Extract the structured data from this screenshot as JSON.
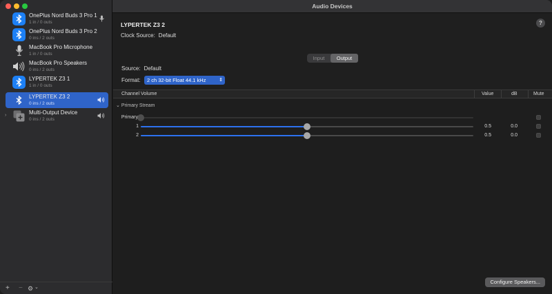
{
  "window": {
    "title": "Audio Devices"
  },
  "sidebar": {
    "devices": [
      {
        "name": "OnePlus Nord Buds 3 Pro 1",
        "sub": "1 in / 0 outs",
        "icon": "bluetooth-icon",
        "right_icon": "microphone-icon",
        "selected": false
      },
      {
        "name": "OnePlus Nord Buds 3 Pro 2",
        "sub": "0 ins / 2 outs",
        "icon": "bluetooth-icon",
        "right_icon": "",
        "selected": false
      },
      {
        "name": "MacBook Pro Microphone",
        "sub": "1 in / 0 outs",
        "icon": "microphone-icon",
        "right_icon": "",
        "selected": false
      },
      {
        "name": "MacBook Pro Speakers",
        "sub": "0 ins / 2 outs",
        "icon": "speaker-icon",
        "right_icon": "",
        "selected": false
      },
      {
        "name": "LYPERTEK Z3 1",
        "sub": "1 in / 0 outs",
        "icon": "bluetooth-icon",
        "right_icon": "",
        "selected": false
      },
      {
        "name": "LYPERTEK Z3 2",
        "sub": "0 ins / 2 outs",
        "icon": "bluetooth-icon",
        "right_icon": "speaker-output-icon",
        "selected": true
      },
      {
        "name": "Multi-Output Device",
        "sub": "0 ins / 2 outs",
        "icon": "multi-output-icon",
        "right_icon": "speaker-output-icon",
        "selected": false
      }
    ],
    "bottom": {
      "add": "+",
      "remove": "−",
      "gear": "⚙",
      "chevron": "⌄"
    }
  },
  "main": {
    "device_title": "LYPERTEK Z3 2",
    "clock_label": "Clock Source:",
    "clock_value": "Default",
    "help": "?",
    "tabs": {
      "input": "Input",
      "output": "Output",
      "active": "output"
    },
    "source_label": "Source:",
    "source_value": "Default",
    "format_label": "Format:",
    "format_value": "2 ch 32-bit Float 44.1 kHz",
    "table": {
      "headers": {
        "channel": "Channel Volume",
        "value": "Value",
        "db": "dB",
        "mute": "Mute"
      },
      "stream": "Primary Stream",
      "rows": [
        {
          "label": "Primary",
          "level": 0,
          "value": "",
          "db": "",
          "enabled": false
        },
        {
          "label": "1",
          "level": 0.5,
          "value": "0.5",
          "db": "0.0",
          "enabled": true
        },
        {
          "label": "2",
          "level": 0.5,
          "value": "0.5",
          "db": "0.0",
          "enabled": true
        }
      ]
    },
    "configure_button": "Configure Speakers..."
  }
}
